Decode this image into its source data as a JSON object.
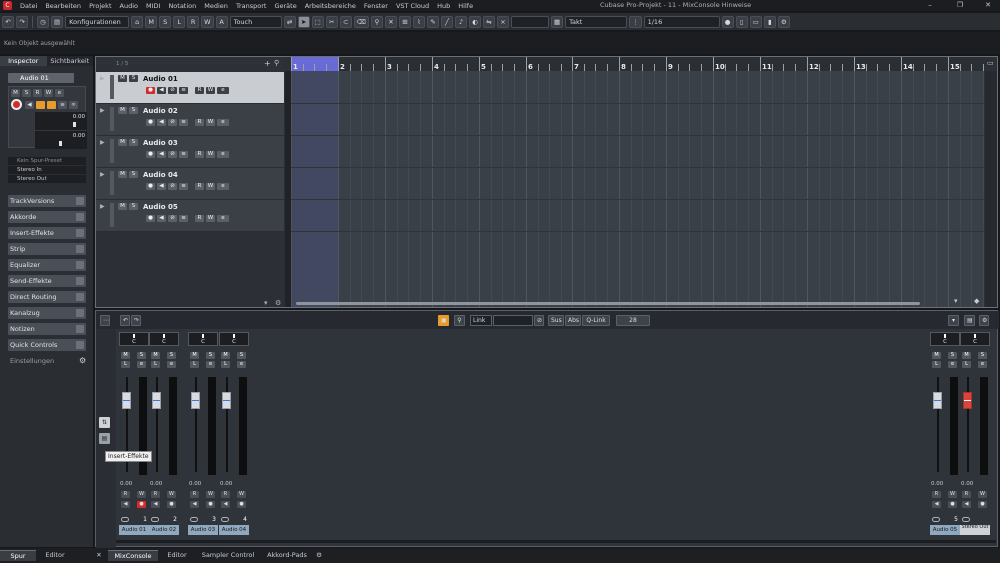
{
  "menu": {
    "items": [
      "Datei",
      "Bearbeiten",
      "Projekt",
      "Audio",
      "MIDI",
      "Notation",
      "Medien",
      "Transport",
      "Geräte",
      "Arbeitsbereiche",
      "Fenster",
      "VST Cloud",
      "Hub",
      "Hilfe"
    ],
    "window_title": "Cubase Pro-Projekt - 11 - MixConsole Hinweise"
  },
  "toolbar": {
    "konfigurationen": "Konfigurationen",
    "touch": "Touch",
    "grid": "Takt",
    "quantize": "1/16",
    "mode_letters": [
      "M",
      "S",
      "L",
      "R",
      "W",
      "A"
    ]
  },
  "status": {
    "text": "Kein Objekt ausgewählt"
  },
  "inspector": {
    "tabs": [
      "Inspector",
      "Sichtbarkeit"
    ],
    "track_name": "Audio 01",
    "level_values": [
      "0.00",
      "0.00"
    ],
    "preset": "Kein Spur-Preset",
    "input": "Stereo In",
    "output": "Stereo Out",
    "sections": [
      "TrackVersions",
      "Akkorde",
      "Insert-Effekte",
      "Strip",
      "Equalizer",
      "Send-Effekte",
      "Direct Routing",
      "Kanalzug",
      "Notizen",
      "Quick Controls"
    ],
    "settings": "Einstellungen"
  },
  "project": {
    "counter": "1 / 5",
    "tracks": [
      {
        "name": "Audio 01",
        "selected": true,
        "record": true
      },
      {
        "name": "Audio 02",
        "selected": false,
        "record": false
      },
      {
        "name": "Audio 03",
        "selected": false,
        "record": false
      },
      {
        "name": "Audio 04",
        "selected": false,
        "record": false
      },
      {
        "name": "Audio 05",
        "selected": false,
        "record": false
      }
    ],
    "bars": [
      "1",
      "2",
      "3",
      "4",
      "5",
      "6",
      "7",
      "8",
      "9",
      "10",
      "11",
      "12",
      "13",
      "14",
      "15"
    ]
  },
  "mixconsole": {
    "link_label": "Link",
    "sus": "Sus",
    "abs": "Abs",
    "qlink": "Q-Link",
    "count": "28",
    "tooltip": "Insert-Effekte",
    "strips": [
      {
        "name": "Audio 01",
        "num": "1",
        "value": "0.00",
        "record": true
      },
      {
        "name": "Audio 02",
        "num": "2",
        "value": "0.00",
        "record": false
      },
      {
        "name": "Audio 03",
        "num": "3",
        "value": "0.00",
        "record": false
      },
      {
        "name": "Audio 04",
        "num": "4",
        "value": "0.00",
        "record": false
      },
      {
        "name": "Audio 05",
        "num": "5",
        "value": "0.00",
        "record": false
      },
      {
        "name": "Stereo Out",
        "num": "",
        "value": "0.00",
        "record": false
      }
    ],
    "pan": "C"
  },
  "bottom_tabs": {
    "left": [
      "Spur",
      "Editor"
    ],
    "right": [
      "MixConsole",
      "Editor",
      "Sampler Control",
      "Akkord-Pads"
    ]
  }
}
